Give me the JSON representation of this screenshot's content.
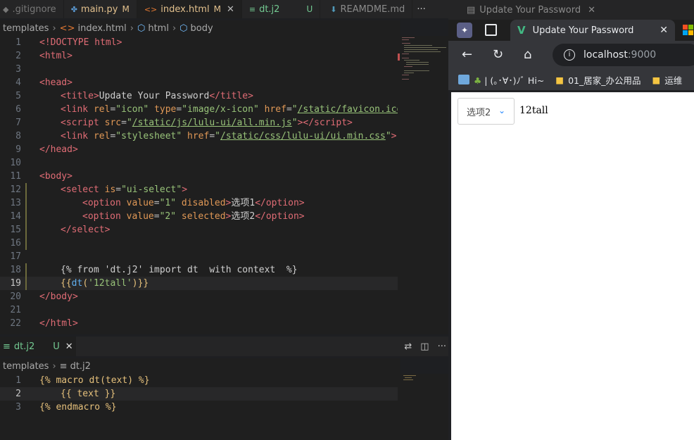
{
  "editor": {
    "tabs": [
      {
        "name": ".gitignore",
        "badge": ""
      },
      {
        "name": "main.py",
        "badge": "M"
      },
      {
        "name": "index.html",
        "badge": "M"
      },
      {
        "name": "dt.j2",
        "badge": "U"
      },
      {
        "name": "REAMDME.md",
        "badge": ""
      }
    ],
    "more_label": "···",
    "breadcrumb": {
      "root": "templates",
      "file": "index.html",
      "el1": "html",
      "el2": "body"
    },
    "lines": {
      "l1": {
        "n": "1"
      },
      "l2": {
        "n": "2"
      },
      "l3": {
        "n": "3"
      },
      "l4": {
        "n": "4"
      },
      "l5": {
        "n": "5"
      },
      "l6": {
        "n": "6"
      },
      "l7": {
        "n": "7"
      },
      "l8": {
        "n": "8"
      },
      "l9": {
        "n": "9"
      },
      "l10": {
        "n": "10"
      },
      "l11": {
        "n": "11"
      },
      "l12": {
        "n": "12"
      },
      "l13": {
        "n": "13"
      },
      "l14": {
        "n": "14"
      },
      "l15": {
        "n": "15"
      },
      "l16": {
        "n": "16"
      },
      "l17": {
        "n": "17"
      },
      "l18": {
        "n": "18"
      },
      "l19": {
        "n": "19"
      },
      "l20": {
        "n": "20"
      },
      "l21": {
        "n": "21"
      },
      "l22": {
        "n": "22"
      }
    },
    "code": {
      "doctype": "<!DOCTYPE html>",
      "html_open": "<html>",
      "head_open": "<head>",
      "title_text": "Update Your Password",
      "link_href_icon": "/static/favicon.ico",
      "script_src": "/static/js/lulu-ui/all.min.js",
      "css_href": "/static/css/lulu-ui/ui.min.css",
      "select_is": "\"ui-select\"",
      "opt1_value": "\"1\"",
      "opt1_text": "选项1",
      "opt2_value": "\"2\"",
      "opt2_text": "选项2",
      "import_line": "{% from 'dt.j2' import dt  with context  %}",
      "call_arg": "'12tall'"
    }
  },
  "bottom_editor": {
    "tab_name": "dt.j2",
    "tab_badge": "U",
    "breadcrumb": {
      "root": "templates",
      "file": "dt.j2"
    },
    "lines": {
      "b1": "1",
      "b2": "2",
      "b3": "3"
    },
    "code": {
      "macro_line": "{% macro dt(text) %}",
      "text_line": "{{ text }}",
      "endmacro_line": "{% endmacro %}"
    },
    "more_label": "···"
  },
  "browser": {
    "window_tab_title": "Update Your Password",
    "tab_title": "Update Your Password",
    "url_host": "localhost",
    "url_port": ":9000",
    "bookmarks": [
      {
        "label": "| (｡･∀･)ﾉﾞ Hi~"
      },
      {
        "label": "01_居家_办公用品"
      },
      {
        "label": "运维"
      }
    ],
    "page": {
      "select_value": "选项2",
      "body_text": "12tall"
    }
  },
  "colors": {
    "editor_bg": "#1f1f1f",
    "tab_modified": "#e2c08d",
    "untracked": "#73c991",
    "browser_chrome": "#35363a",
    "select_arrow": "#2486ff"
  }
}
